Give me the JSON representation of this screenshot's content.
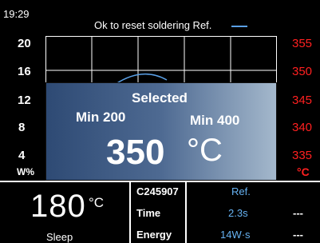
{
  "header": {
    "clock": "19:29",
    "message": "Ok to reset soldering Ref.",
    "accent_color": "#5aa0e6"
  },
  "graph": {
    "left_axis": [
      "20",
      "16",
      "12",
      "8",
      "4"
    ],
    "left_unit": "W%",
    "right_axis": [
      "355",
      "350",
      "345",
      "340",
      "335"
    ],
    "right_unit": "°C",
    "right_axis_color": "#ff2020",
    "curve_color": "#5aa0e6"
  },
  "popup": {
    "title": "Selected",
    "min_label": "Min 200",
    "max_label": "Min 400",
    "value": "350",
    "unit": "°C"
  },
  "status": {
    "tip_temp": "180",
    "tip_unit": "°C",
    "mode": "Sleep"
  },
  "info_table": {
    "rows": [
      {
        "label": "C245907",
        "value": "Ref.",
        "extra": ""
      },
      {
        "label": "Time",
        "value": "2.3s",
        "extra": "---"
      },
      {
        "label": "Energy",
        "value": "14W·s",
        "extra": "---"
      }
    ]
  }
}
